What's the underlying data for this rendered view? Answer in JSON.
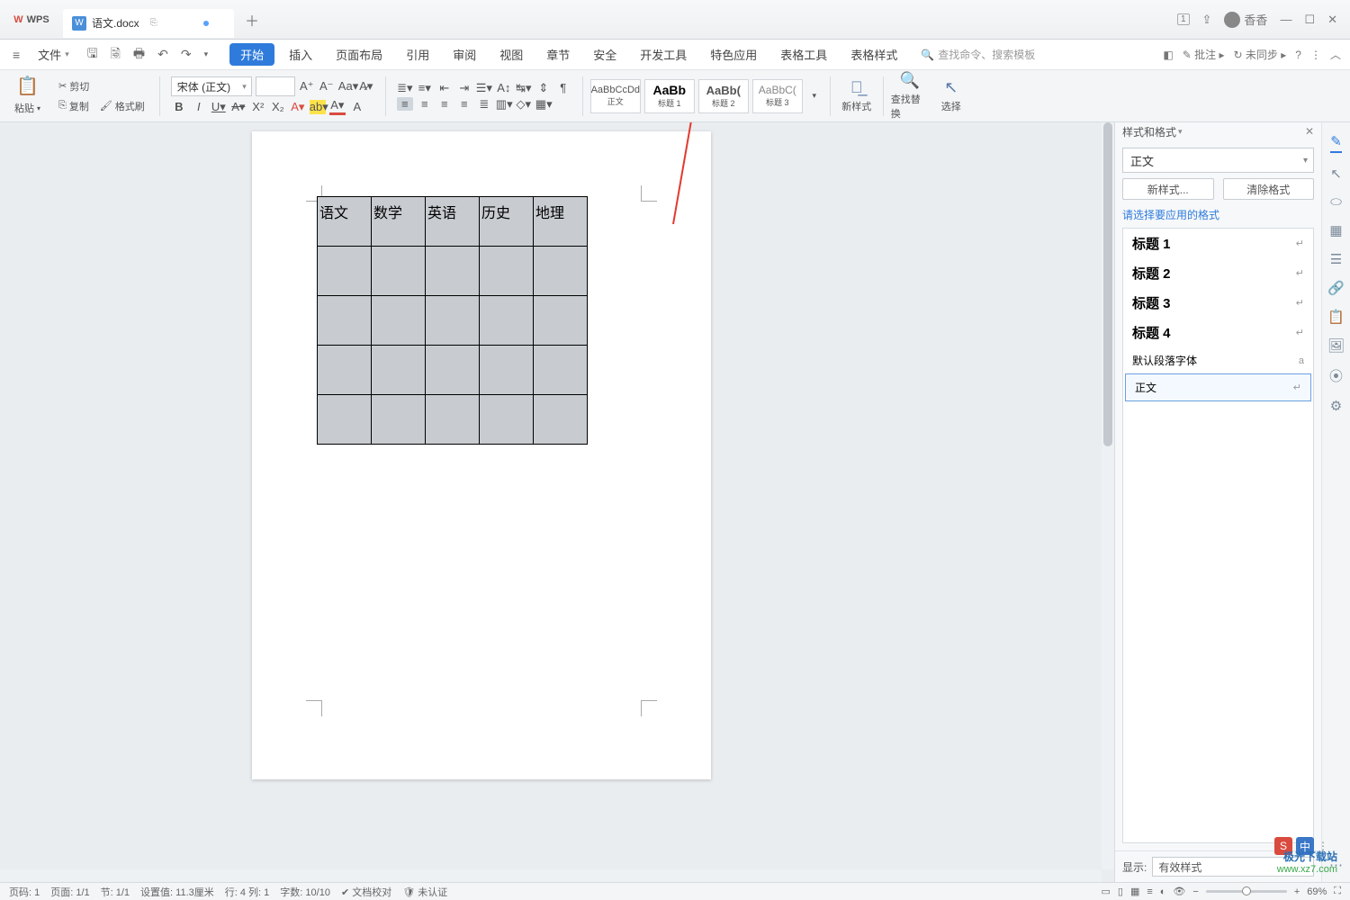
{
  "title": {
    "brand": "WPS",
    "doc_name": "语文.docx"
  },
  "win": {
    "badge": "1",
    "user": "香香"
  },
  "menu": {
    "file": "文件",
    "tabs": [
      "开始",
      "插入",
      "页面布局",
      "引用",
      "审阅",
      "视图",
      "章节",
      "安全",
      "开发工具",
      "特色应用",
      "表格工具",
      "表格样式"
    ],
    "active": "开始",
    "search_placeholder": "查找命令、搜索模板",
    "right": {
      "comment": "批注",
      "sync": "未同步"
    }
  },
  "ribbon": {
    "paste": "粘贴",
    "cut": "剪切",
    "copy": "复制",
    "fmtbrush": "格式刷",
    "font_name": "宋体 (正文)",
    "font_size": "",
    "styles": [
      {
        "preview": "AaBbCcDd",
        "name": "正文"
      },
      {
        "preview": "AaBb",
        "name": "标题 1"
      },
      {
        "preview": "AaBb(",
        "name": "标题 2"
      },
      {
        "preview": "AaBbC(",
        "name": "标题 3"
      }
    ],
    "new_style": "新样式",
    "find_replace": "查找替换",
    "select": "选择"
  },
  "table": {
    "headers": [
      "语文",
      "数学",
      "英语",
      "历史",
      "地理"
    ]
  },
  "panel": {
    "title": "样式和格式",
    "current": "正文",
    "btn_new": "新样式...",
    "btn_clear": "清除格式",
    "hint": "请选择要应用的格式",
    "items": [
      {
        "label": "标题 1"
      },
      {
        "label": "标题 2"
      },
      {
        "label": "标题 3"
      },
      {
        "label": "标题 4"
      },
      {
        "label": "默认段落字体",
        "small": true,
        "glyph": "a"
      },
      {
        "label": "正文",
        "selected": true
      }
    ],
    "show_label": "显示:",
    "show_value": "有效样式"
  },
  "status": {
    "items": [
      "页码: 1",
      "页面: 1/1",
      "节: 1/1",
      "设置值: 11.3厘米",
      "行: 4  列: 1",
      "字数: 10/10",
      "文档校对",
      "未认证"
    ],
    "zoom": "69%"
  },
  "watermark": {
    "l1": "极光下载站",
    "l2": "www.xz7.com"
  },
  "ime": {
    "a": "S",
    "b": "中"
  }
}
